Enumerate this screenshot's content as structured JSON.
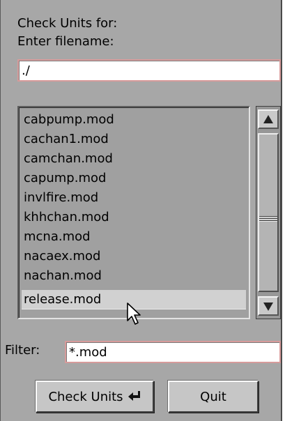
{
  "prompt": {
    "line1": "Check Units for:",
    "line2": "Enter filename:"
  },
  "filename": {
    "value": "./"
  },
  "file_list": {
    "items": [
      "cabpump.mod",
      "cachan1.mod",
      "camchan.mod",
      "capump.mod",
      "invlfire.mod",
      "khhchan.mod",
      "mcna.mod",
      "nacaex.mod",
      "nachan.mod",
      "release.mod"
    ],
    "selected": "release.mod"
  },
  "filter": {
    "label": "Filter:",
    "value": "*.mod"
  },
  "buttons": {
    "check_units": "Check Units",
    "quit": "Quit"
  },
  "icons": {
    "scroll_up": "scroll-up-arrow-icon",
    "scroll_down": "scroll-down-arrow-icon",
    "enter": "enter-return-icon",
    "cursor": "mouse-pointer-icon"
  },
  "colors": {
    "dialog_bg": "#a7a7a7",
    "field_border": "#d79b9b",
    "selection": "#d1d1d1",
    "caret": "#cc0000"
  }
}
